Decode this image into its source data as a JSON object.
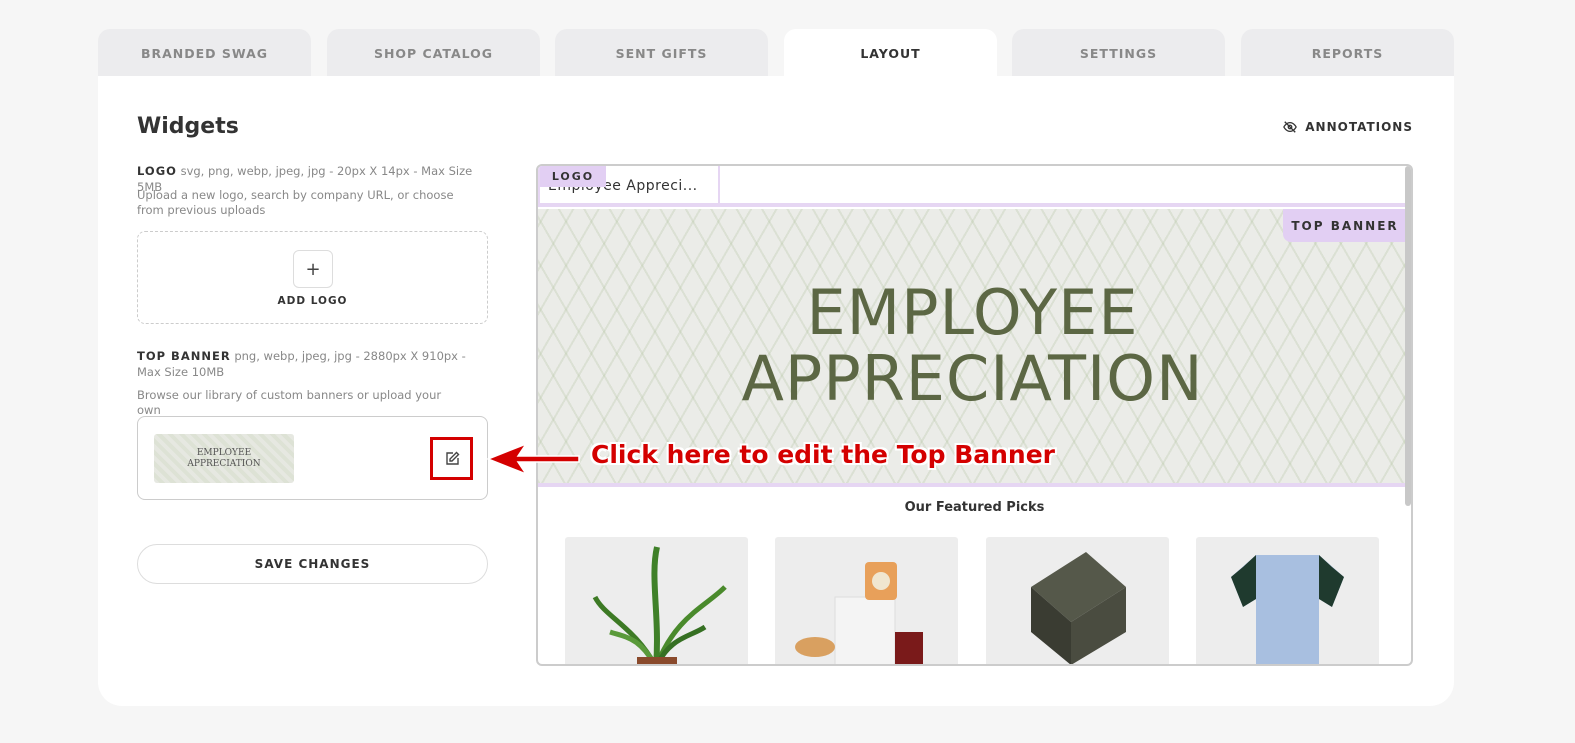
{
  "tabs": [
    {
      "label": "BRANDED SWAG"
    },
    {
      "label": "SHOP CATALOG"
    },
    {
      "label": "SENT GIFTS"
    },
    {
      "label": "LAYOUT"
    },
    {
      "label": "SETTINGS"
    },
    {
      "label": "REPORTS"
    }
  ],
  "active_tab": "LAYOUT",
  "widgets": {
    "title": "Widgets",
    "annotations_label": "ANNOTATIONS",
    "logo": {
      "label": "LOGO",
      "spec": "svg, png, webp, jpeg, jpg - 20px X 14px - Max Size 5MB",
      "help": "Upload a new logo, search by company URL, or choose from previous uploads",
      "add_label": "ADD LOGO",
      "plus": "+"
    },
    "top_banner": {
      "label": "TOP BANNER",
      "spec": "png, webp, jpeg, jpg - 2880px X 910px - Max Size 10MB",
      "help": "Browse our library of custom banners or upload your own",
      "thumb_line1": "EMPLOYEE",
      "thumb_line2": "APPRECIATION"
    },
    "save_label": "SAVE CHANGES"
  },
  "preview": {
    "logo_text": "Employee Appreci...",
    "logo_tag": "LOGO",
    "banner_tag": "TOP BANNER",
    "banner_line1": "EMPLOYEE",
    "banner_line2": "APPRECIATION",
    "featured_title": "Our Featured Picks"
  },
  "callout": "Click here to edit the Top Banner",
  "colors": {
    "accent_tag": "#e2cff3",
    "callout": "#d40000",
    "banner_text": "#5c6744"
  },
  "icons": [
    "eye-slash-icon",
    "plus-icon",
    "edit-icon",
    "arrow-left-icon"
  ]
}
